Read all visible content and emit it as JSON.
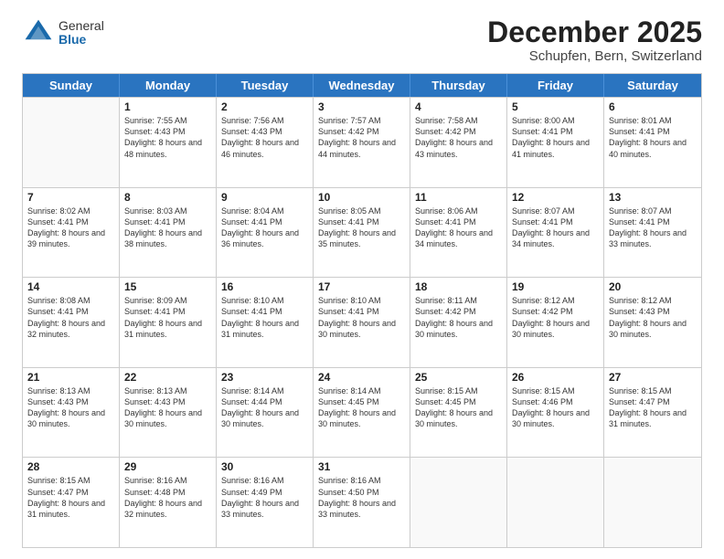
{
  "logo": {
    "general": "General",
    "blue": "Blue"
  },
  "title": "December 2025",
  "subtitle": "Schupfen, Bern, Switzerland",
  "days_of_week": [
    "Sunday",
    "Monday",
    "Tuesday",
    "Wednesday",
    "Thursday",
    "Friday",
    "Saturday"
  ],
  "weeks": [
    [
      {
        "day": "",
        "info": ""
      },
      {
        "day": "1",
        "info": "Sunrise: 7:55 AM\nSunset: 4:43 PM\nDaylight: 8 hours\nand 48 minutes."
      },
      {
        "day": "2",
        "info": "Sunrise: 7:56 AM\nSunset: 4:43 PM\nDaylight: 8 hours\nand 46 minutes."
      },
      {
        "day": "3",
        "info": "Sunrise: 7:57 AM\nSunset: 4:42 PM\nDaylight: 8 hours\nand 44 minutes."
      },
      {
        "day": "4",
        "info": "Sunrise: 7:58 AM\nSunset: 4:42 PM\nDaylight: 8 hours\nand 43 minutes."
      },
      {
        "day": "5",
        "info": "Sunrise: 8:00 AM\nSunset: 4:41 PM\nDaylight: 8 hours\nand 41 minutes."
      },
      {
        "day": "6",
        "info": "Sunrise: 8:01 AM\nSunset: 4:41 PM\nDaylight: 8 hours\nand 40 minutes."
      }
    ],
    [
      {
        "day": "7",
        "info": "Sunrise: 8:02 AM\nSunset: 4:41 PM\nDaylight: 8 hours\nand 39 minutes."
      },
      {
        "day": "8",
        "info": "Sunrise: 8:03 AM\nSunset: 4:41 PM\nDaylight: 8 hours\nand 38 minutes."
      },
      {
        "day": "9",
        "info": "Sunrise: 8:04 AM\nSunset: 4:41 PM\nDaylight: 8 hours\nand 36 minutes."
      },
      {
        "day": "10",
        "info": "Sunrise: 8:05 AM\nSunset: 4:41 PM\nDaylight: 8 hours\nand 35 minutes."
      },
      {
        "day": "11",
        "info": "Sunrise: 8:06 AM\nSunset: 4:41 PM\nDaylight: 8 hours\nand 34 minutes."
      },
      {
        "day": "12",
        "info": "Sunrise: 8:07 AM\nSunset: 4:41 PM\nDaylight: 8 hours\nand 34 minutes."
      },
      {
        "day": "13",
        "info": "Sunrise: 8:07 AM\nSunset: 4:41 PM\nDaylight: 8 hours\nand 33 minutes."
      }
    ],
    [
      {
        "day": "14",
        "info": "Sunrise: 8:08 AM\nSunset: 4:41 PM\nDaylight: 8 hours\nand 32 minutes."
      },
      {
        "day": "15",
        "info": "Sunrise: 8:09 AM\nSunset: 4:41 PM\nDaylight: 8 hours\nand 31 minutes."
      },
      {
        "day": "16",
        "info": "Sunrise: 8:10 AM\nSunset: 4:41 PM\nDaylight: 8 hours\nand 31 minutes."
      },
      {
        "day": "17",
        "info": "Sunrise: 8:10 AM\nSunset: 4:41 PM\nDaylight: 8 hours\nand 30 minutes."
      },
      {
        "day": "18",
        "info": "Sunrise: 8:11 AM\nSunset: 4:42 PM\nDaylight: 8 hours\nand 30 minutes."
      },
      {
        "day": "19",
        "info": "Sunrise: 8:12 AM\nSunset: 4:42 PM\nDaylight: 8 hours\nand 30 minutes."
      },
      {
        "day": "20",
        "info": "Sunrise: 8:12 AM\nSunset: 4:43 PM\nDaylight: 8 hours\nand 30 minutes."
      }
    ],
    [
      {
        "day": "21",
        "info": "Sunrise: 8:13 AM\nSunset: 4:43 PM\nDaylight: 8 hours\nand 30 minutes."
      },
      {
        "day": "22",
        "info": "Sunrise: 8:13 AM\nSunset: 4:43 PM\nDaylight: 8 hours\nand 30 minutes."
      },
      {
        "day": "23",
        "info": "Sunrise: 8:14 AM\nSunset: 4:44 PM\nDaylight: 8 hours\nand 30 minutes."
      },
      {
        "day": "24",
        "info": "Sunrise: 8:14 AM\nSunset: 4:45 PM\nDaylight: 8 hours\nand 30 minutes."
      },
      {
        "day": "25",
        "info": "Sunrise: 8:15 AM\nSunset: 4:45 PM\nDaylight: 8 hours\nand 30 minutes."
      },
      {
        "day": "26",
        "info": "Sunrise: 8:15 AM\nSunset: 4:46 PM\nDaylight: 8 hours\nand 30 minutes."
      },
      {
        "day": "27",
        "info": "Sunrise: 8:15 AM\nSunset: 4:47 PM\nDaylight: 8 hours\nand 31 minutes."
      }
    ],
    [
      {
        "day": "28",
        "info": "Sunrise: 8:15 AM\nSunset: 4:47 PM\nDaylight: 8 hours\nand 31 minutes."
      },
      {
        "day": "29",
        "info": "Sunrise: 8:16 AM\nSunset: 4:48 PM\nDaylight: 8 hours\nand 32 minutes."
      },
      {
        "day": "30",
        "info": "Sunrise: 8:16 AM\nSunset: 4:49 PM\nDaylight: 8 hours\nand 33 minutes."
      },
      {
        "day": "31",
        "info": "Sunrise: 8:16 AM\nSunset: 4:50 PM\nDaylight: 8 hours\nand 33 minutes."
      },
      {
        "day": "",
        "info": ""
      },
      {
        "day": "",
        "info": ""
      },
      {
        "day": "",
        "info": ""
      }
    ]
  ]
}
